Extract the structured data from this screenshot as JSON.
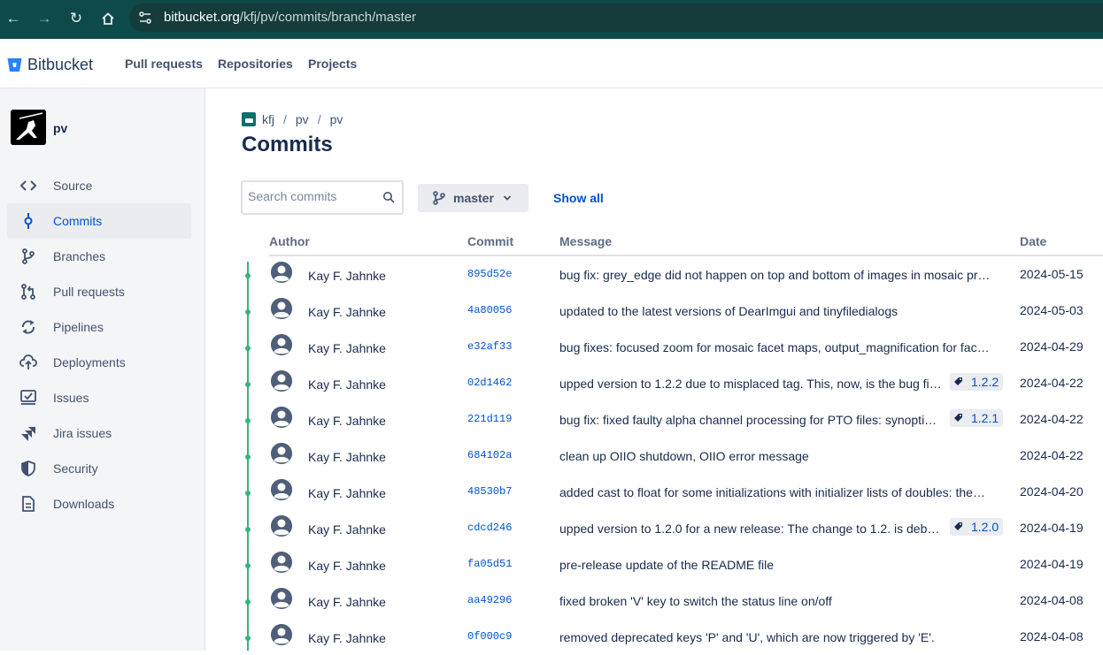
{
  "browser": {
    "url_host": "bitbucket.org",
    "url_path": "/kfj/pv/commits/branch/master"
  },
  "topnav": {
    "brand": "Bitbucket",
    "links": [
      "Pull requests",
      "Repositories",
      "Projects"
    ]
  },
  "sidebar": {
    "repo_name": "pv",
    "items": [
      {
        "label": "Source",
        "icon": "code-icon"
      },
      {
        "label": "Commits",
        "icon": "commit-icon",
        "active": true
      },
      {
        "label": "Branches",
        "icon": "branch-icon"
      },
      {
        "label": "Pull requests",
        "icon": "pull-request-icon"
      },
      {
        "label": "Pipelines",
        "icon": "pipelines-icon"
      },
      {
        "label": "Deployments",
        "icon": "deployments-icon"
      },
      {
        "label": "Issues",
        "icon": "issues-icon"
      },
      {
        "label": "Jira issues",
        "icon": "jira-icon"
      },
      {
        "label": "Security",
        "icon": "shield-icon"
      },
      {
        "label": "Downloads",
        "icon": "document-icon"
      }
    ]
  },
  "breadcrumb": [
    "kfj",
    "pv",
    "pv"
  ],
  "page_title": "Commits",
  "search": {
    "placeholder": "Search commits"
  },
  "branch": {
    "label": "master"
  },
  "show_all_label": "Show all",
  "table": {
    "headers": {
      "author": "Author",
      "commit": "Commit",
      "message": "Message",
      "date": "Date"
    },
    "rows": [
      {
        "author": "Kay F. Jahnke",
        "hash": "895d52e",
        "message": "bug fix: grey_edge did not happen on top and bottom of images in mosaic pr…",
        "tag": "",
        "date": "2024-05-15"
      },
      {
        "author": "Kay F. Jahnke",
        "hash": "4a80056",
        "message": "updated to the latest versions of DearImgui and tinyfiledialogs",
        "tag": "",
        "date": "2024-05-03"
      },
      {
        "author": "Kay F. Jahnke",
        "hash": "e32af33",
        "message": "bug fixes: focused zoom for mosaic facet maps, output_magnification for fac…",
        "tag": "",
        "date": "2024-04-29"
      },
      {
        "author": "Kay F. Jahnke",
        "hash": "02d1462",
        "message": "upped version to 1.2.2 due to misplaced tag. This, now, is the bug fi…",
        "tag": "1.2.2",
        "date": "2024-04-22"
      },
      {
        "author": "Kay F. Jahnke",
        "hash": "221d119",
        "message": "bug fix: fixed faulty alpha channel processing for PTO files: synopti…",
        "tag": "1.2.1",
        "date": "2024-04-22"
      },
      {
        "author": "Kay F. Jahnke",
        "hash": "684102a",
        "message": "clean up OIIO shutdown, OIIO error message",
        "tag": "",
        "date": "2024-04-22"
      },
      {
        "author": "Kay F. Jahnke",
        "hash": "48530b7",
        "message": "added cast to float for some initializations with initializer lists of doubles: the…",
        "tag": "",
        "date": "2024-04-20"
      },
      {
        "author": "Kay F. Jahnke",
        "hash": "cdcd246",
        "message": "upped version to 1.2.0 for a new release: The change to 1.2. is deb…",
        "tag": "1.2.0",
        "date": "2024-04-19"
      },
      {
        "author": "Kay F. Jahnke",
        "hash": "fa05d51",
        "message": "pre-release update of the README file",
        "tag": "",
        "date": "2024-04-19"
      },
      {
        "author": "Kay F. Jahnke",
        "hash": "aa49296",
        "message": "fixed broken 'V' key to switch the status line on/off",
        "tag": "",
        "date": "2024-04-08"
      },
      {
        "author": "Kay F. Jahnke",
        "hash": "0f000c9",
        "message": "removed deprecated keys 'P' and 'U', which are now triggered by 'E'.",
        "tag": "",
        "date": "2024-04-08"
      }
    ]
  },
  "colors": {
    "accent": "#0052cc",
    "graph": "#36b37e",
    "browser_bar": "#0e4a4a"
  }
}
